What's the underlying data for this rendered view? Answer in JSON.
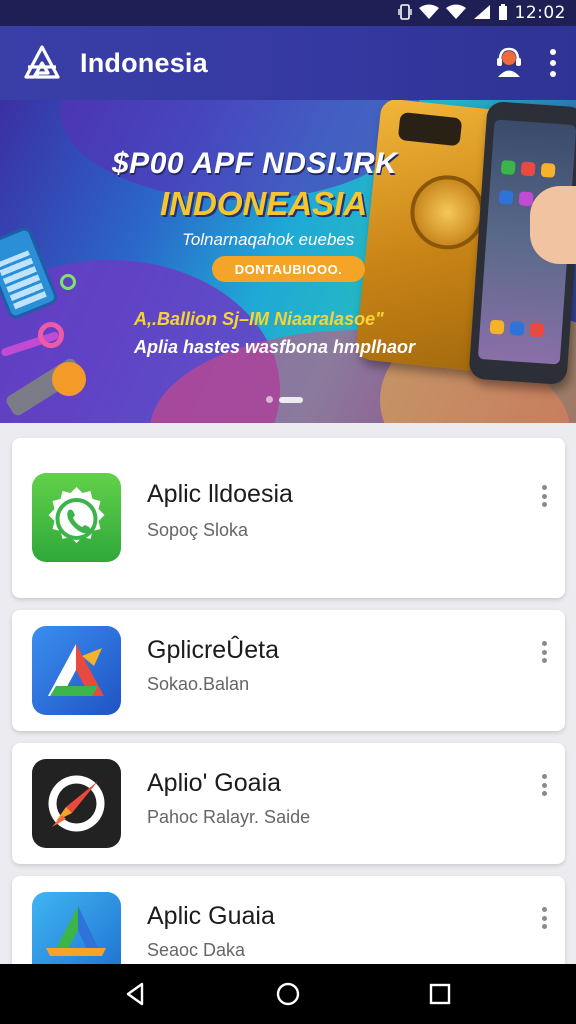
{
  "status_bar": {
    "time": "12:02",
    "icons": [
      "vibrate-icon",
      "wifi-icon",
      "signal-icon",
      "battery-icon"
    ]
  },
  "app_bar": {
    "title": "Indonesia",
    "icons": [
      "app-logo-icon",
      "support-agent-icon",
      "more-vert-icon"
    ]
  },
  "banner": {
    "headline": "$P00 APF NDSIJRK",
    "subhead": "INDONEASIA",
    "tagline": "Tolnarnaqahok euebes",
    "pill_label": "DONTAUBIOOO.",
    "line1": "A,.Ballion Sj–IM Niaaralasoe\"",
    "line2": "Aplia hastes wasfbona hmplhaor",
    "slide_count": 2,
    "active_slide": 2
  },
  "apps": [
    {
      "name": "Aplic lldoesia",
      "subtitle": "Sopoç Sloka",
      "icon": "whatsapp-style-icon",
      "icon_color": "#3bb54a"
    },
    {
      "name": "GplicreÛeta",
      "subtitle": "Sokao.Balan",
      "icon": "triangle-logo-icon",
      "icon_color": "#2d73d8"
    },
    {
      "name": "Aplio' Goaia",
      "subtitle": "Pahoc Ralayr. Saide",
      "icon": "rocket-icon",
      "icon_color": "#222222"
    },
    {
      "name": "Aplic Guaia",
      "subtitle": "Seaoc Daka",
      "icon": "triangle-logo-icon",
      "icon_color": "#2a8fe0"
    }
  ],
  "nav_bar": {
    "icons": [
      "back-icon",
      "home-icon",
      "recents-icon"
    ]
  },
  "colors": {
    "status_bar": "#1d1f55",
    "app_bar": "#3a3fa8",
    "background": "#ececf0",
    "nav_bar": "#000000"
  }
}
